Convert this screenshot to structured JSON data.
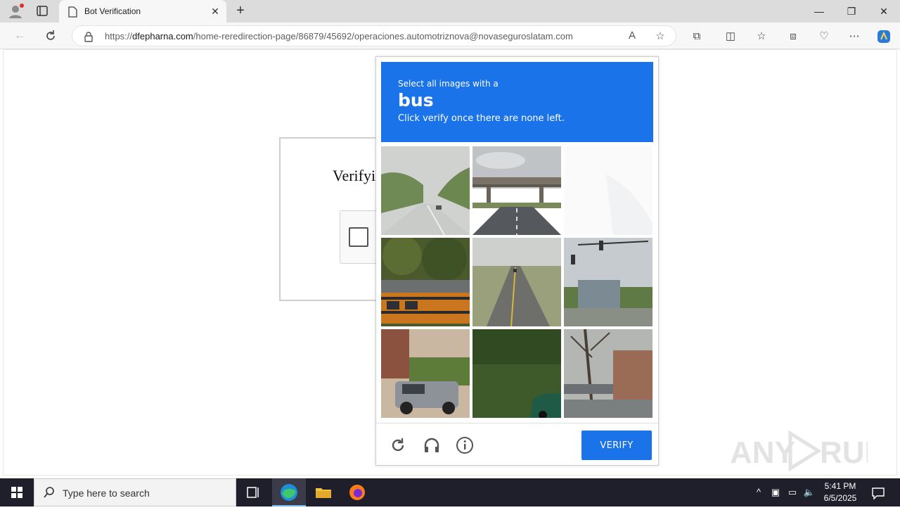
{
  "browser": {
    "tab_title": "Bot Verification",
    "url_host": "dfepharna.com",
    "url_path": "/home-reredirection-page/86879/45692/operaciones.automotriznova@novaseguroslatam.com",
    "url_scheme": "https://"
  },
  "page": {
    "heading": "Verifyi"
  },
  "challenge": {
    "line1": "Select all images with a",
    "target": "bus",
    "line3": "Click verify once there are none left.",
    "verify_label": "VERIFY",
    "accent": "#1a73e8",
    "tiles": [
      {
        "name": "tile-highway-trees",
        "icon": "highway-image"
      },
      {
        "name": "tile-overpass",
        "icon": "overpass-image"
      },
      {
        "name": "tile-blank",
        "icon": "faded-blank-image"
      },
      {
        "name": "tile-school-bus",
        "icon": "school-bus-image"
      },
      {
        "name": "tile-rural-road",
        "icon": "road-image"
      },
      {
        "name": "tile-traffic-light",
        "icon": "traffic-light-image"
      },
      {
        "name": "tile-suv-parked",
        "icon": "suv-image"
      },
      {
        "name": "tile-grass-car",
        "icon": "grass-image"
      },
      {
        "name": "tile-parking-trees",
        "icon": "parking-lot-image"
      }
    ]
  },
  "taskbar": {
    "search_placeholder": "Type here to search",
    "time": "5:41 PM",
    "date": "6/5/2025"
  },
  "watermark": "ANY RUN"
}
